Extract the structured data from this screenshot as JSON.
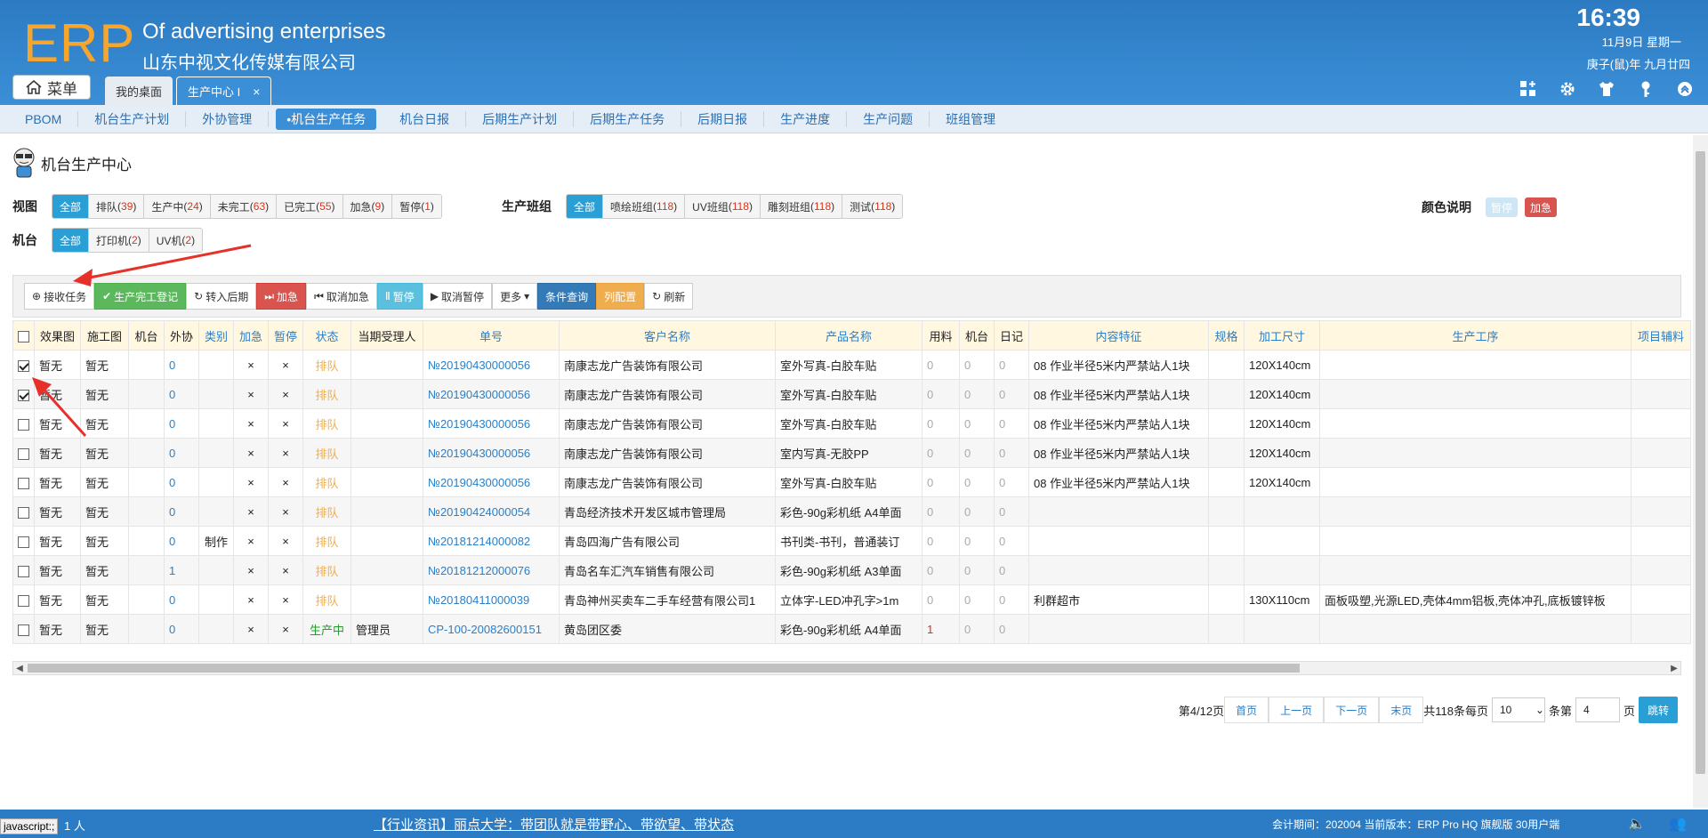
{
  "header": {
    "logo": "ERP",
    "title": "Of advertising enterprises",
    "company": "山东中视文化传媒有限公司",
    "time": "16:39",
    "date": "11月9日 星期一",
    "lunar": "庚子(鼠)年 九月廿四",
    "menu_label": "菜单",
    "tabs": [
      {
        "label": "我的桌面"
      },
      {
        "label": "生产中心 I",
        "close": "×"
      }
    ]
  },
  "subnav": [
    "PBOM",
    "机台生产计划",
    "外协管理",
    "•机台生产任务",
    "机台日报",
    "后期生产计划",
    "后期生产任务",
    "后期日报",
    "生产进度",
    "生产问题",
    "班组管理"
  ],
  "page_title": "机台生产中心",
  "view": {
    "label": "视图",
    "options": [
      {
        "text": "全部",
        "count": ""
      },
      {
        "text": "排队",
        "count": "39"
      },
      {
        "text": "生产中",
        "count": "24"
      },
      {
        "text": "未完工",
        "count": "63"
      },
      {
        "text": "已完工",
        "count": "55"
      },
      {
        "text": "加急",
        "count": "9"
      },
      {
        "text": "暂停",
        "count": "1"
      }
    ]
  },
  "team": {
    "label": "生产班组",
    "options": [
      {
        "text": "全部",
        "count": ""
      },
      {
        "text": "喷绘班组",
        "count": "118"
      },
      {
        "text": "UV班组",
        "count": "118"
      },
      {
        "text": "雕刻班组",
        "count": "118"
      },
      {
        "text": "测试",
        "count": "118"
      }
    ]
  },
  "machine": {
    "label": "机台",
    "options": [
      {
        "text": "全部",
        "count": ""
      },
      {
        "text": "打印机",
        "count": "2"
      },
      {
        "text": "UV机",
        "count": "2"
      }
    ]
  },
  "legend": {
    "label": "颜色说明",
    "paused": "暂停",
    "urgent": "加急",
    "paused_color": "#cde6f5",
    "urgent_color": "#d9534f"
  },
  "toolbar": {
    "receive": "接收任务",
    "finish": "生产完工登记",
    "to_later": "转入后期",
    "urgent": "加急",
    "cancel_urgent": "取消加急",
    "pause": "暂停",
    "cancel_pause": "取消暂停",
    "more": "更多",
    "query": "条件查询",
    "columns": "列配置",
    "refresh": "刷新"
  },
  "table": {
    "headers": [
      "效果图",
      "施工图",
      "机台",
      "外协",
      "类别",
      "加急",
      "暂停",
      "状态",
      "当期受理人",
      "单号",
      "客户名称",
      "产品名称",
      "用料",
      "机台",
      "日记",
      "内容特征",
      "规格",
      "加工尺寸",
      "生产工序",
      "项目辅料"
    ],
    "rows": [
      {
        "checked": true,
        "eff": "暂无",
        "con": "暂无",
        "mach": "",
        "out": "0",
        "cat": "",
        "urg": "×",
        "pau": "×",
        "status": "排队",
        "person": "",
        "no": "№20190430000056",
        "customer": "南康志龙广告装饰有限公司",
        "product": "室外写真-白胶车贴",
        "mat": "0",
        "m2": "0",
        "log": "0",
        "content": "08 作业半径5米内严禁站人1块",
        "spec": "",
        "size": "120X140cm",
        "process": "",
        "aux": ""
      },
      {
        "checked": true,
        "eff": "暂无",
        "con": "暂无",
        "mach": "",
        "out": "0",
        "cat": "",
        "urg": "×",
        "pau": "×",
        "status": "排队",
        "person": "",
        "no": "№20190430000056",
        "customer": "南康志龙广告装饰有限公司",
        "product": "室外写真-白胶车贴",
        "mat": "0",
        "m2": "0",
        "log": "0",
        "content": "08 作业半径5米内严禁站人1块",
        "spec": "",
        "size": "120X140cm",
        "process": "",
        "aux": ""
      },
      {
        "checked": false,
        "eff": "暂无",
        "con": "暂无",
        "mach": "",
        "out": "0",
        "cat": "",
        "urg": "×",
        "pau": "×",
        "status": "排队",
        "person": "",
        "no": "№20190430000056",
        "customer": "南康志龙广告装饰有限公司",
        "product": "室外写真-白胶车贴",
        "mat": "0",
        "m2": "0",
        "log": "0",
        "content": "08 作业半径5米内严禁站人1块",
        "spec": "",
        "size": "120X140cm",
        "process": "",
        "aux": ""
      },
      {
        "checked": false,
        "eff": "暂无",
        "con": "暂无",
        "mach": "",
        "out": "0",
        "cat": "",
        "urg": "×",
        "pau": "×",
        "status": "排队",
        "person": "",
        "no": "№20190430000056",
        "customer": "南康志龙广告装饰有限公司",
        "product": "室内写真-无胶PP",
        "mat": "0",
        "m2": "0",
        "log": "0",
        "content": "08 作业半径5米内严禁站人1块",
        "spec": "",
        "size": "120X140cm",
        "process": "",
        "aux": ""
      },
      {
        "checked": false,
        "eff": "暂无",
        "con": "暂无",
        "mach": "",
        "out": "0",
        "cat": "",
        "urg": "×",
        "pau": "×",
        "status": "排队",
        "person": "",
        "no": "№20190430000056",
        "customer": "南康志龙广告装饰有限公司",
        "product": "室外写真-白胶车贴",
        "mat": "0",
        "m2": "0",
        "log": "0",
        "content": "08 作业半径5米内严禁站人1块",
        "spec": "",
        "size": "120X140cm",
        "process": "",
        "aux": ""
      },
      {
        "checked": false,
        "eff": "暂无",
        "con": "暂无",
        "mach": "",
        "out": "0",
        "cat": "",
        "urg": "×",
        "pau": "×",
        "status": "排队",
        "person": "",
        "no": "№20190424000054",
        "customer": "青岛经济技术开发区城市管理局",
        "product": "彩色-90g彩机纸 A4单面",
        "mat": "0",
        "m2": "0",
        "log": "0",
        "content": "",
        "spec": "",
        "size": "",
        "process": "",
        "aux": ""
      },
      {
        "checked": false,
        "eff": "暂无",
        "con": "暂无",
        "mach": "",
        "out": "0",
        "cat": "制作",
        "urg": "×",
        "pau": "×",
        "status": "排队",
        "person": "",
        "no": "№20181214000082",
        "customer": "青岛四海广告有限公司",
        "product": "书刊类-书刊，普通装订",
        "mat": "0",
        "m2": "0",
        "log": "0",
        "content": "",
        "spec": "",
        "size": "",
        "process": "",
        "aux": ""
      },
      {
        "checked": false,
        "eff": "暂无",
        "con": "暂无",
        "mach": "",
        "out": "1",
        "cat": "",
        "urg": "×",
        "pau": "×",
        "status": "排队",
        "person": "",
        "no": "№20181212000076",
        "customer": "青岛名车汇汽车销售有限公司",
        "product": "彩色-90g彩机纸 A3单面",
        "mat": "0",
        "m2": "0",
        "log": "0",
        "content": "",
        "spec": "",
        "size": "",
        "process": "",
        "aux": ""
      },
      {
        "checked": false,
        "eff": "暂无",
        "con": "暂无",
        "mach": "",
        "out": "0",
        "cat": "",
        "urg": "×",
        "pau": "×",
        "status": "排队",
        "person": "",
        "no": "№20180411000039",
        "customer": "青岛神州买卖车二手车经营有限公司1",
        "product": "立体字-LED冲孔字>1m",
        "mat": "0",
        "m2": "0",
        "log": "0",
        "content": "利群超市",
        "spec": "",
        "size": "130X110cm",
        "process": "面板吸塑,光源LED,壳体4mm铝板,壳体冲孔,底板镀锌板",
        "aux": ""
      },
      {
        "checked": false,
        "eff": "暂无",
        "con": "暂无",
        "mach": "",
        "out": "0",
        "cat": "",
        "urg": "×",
        "pau": "×",
        "status": "生产中",
        "person": "管理员",
        "no": "CP-100-20082600151",
        "customer": "黄岛团区委",
        "product": "彩色-90g彩机纸 A4单面",
        "mat": "1",
        "m2": "0",
        "log": "0",
        "content": "",
        "spec": "",
        "size": "",
        "process": "",
        "aux": ""
      }
    ]
  },
  "pager": {
    "page_info": "第4/12页",
    "first": "首页",
    "prev": "上一页",
    "next": "下一页",
    "last": "末页",
    "total": "共118条每页",
    "page_size": "10",
    "per_unit": "条第",
    "page_input": "4",
    "page_unit": "页",
    "go": "跳转"
  },
  "footer": {
    "status_text": "javascript:;",
    "online": "1  人",
    "news": "【行业资讯】丽点大学：带团队就是带野心、带欲望、带状态",
    "info": "会计期间：202004 当前版本：ERP Pro HQ 旗舰版 30用户端"
  }
}
